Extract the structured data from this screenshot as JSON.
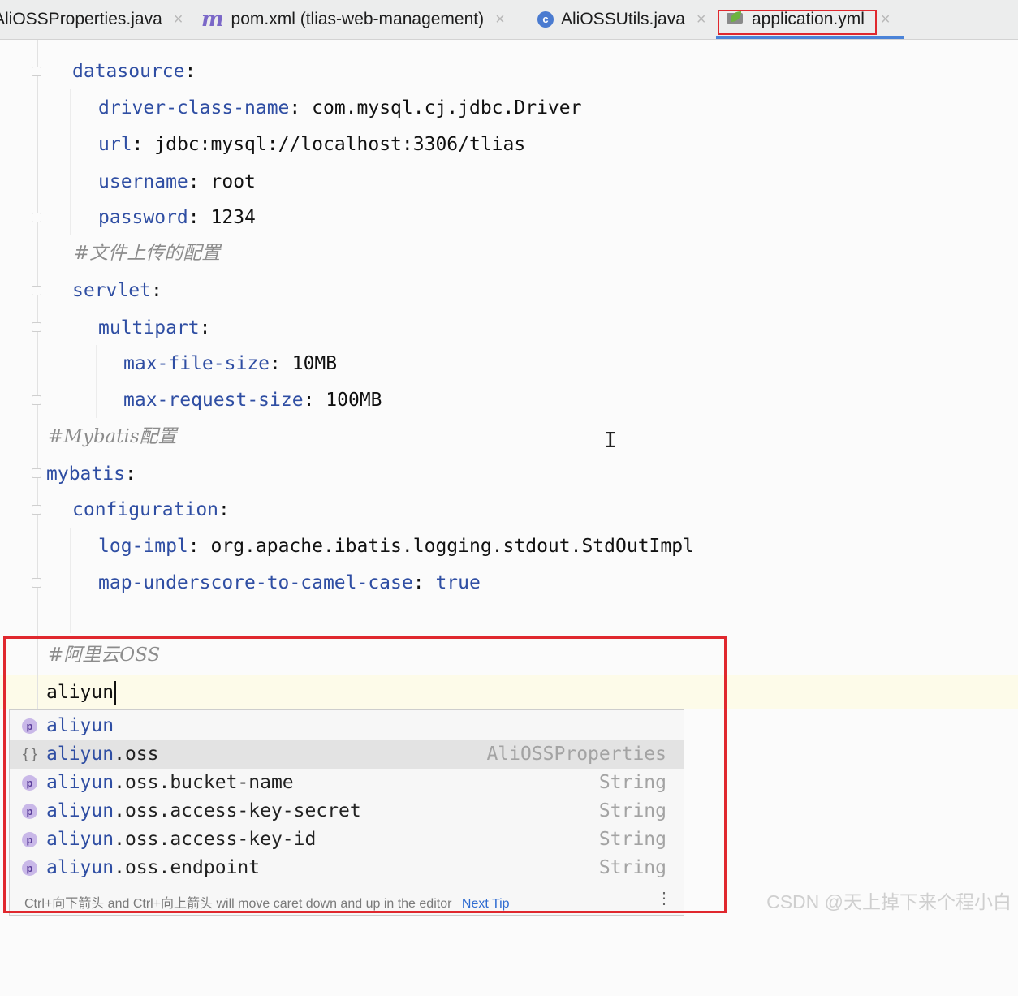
{
  "tabs": [
    {
      "label": "AliOSSProperties.java",
      "icon": "java-class-icon"
    },
    {
      "label": "pom.xml (tlias-web-management)",
      "icon": "maven-icon"
    },
    {
      "label": "AliOSSUtils.java",
      "icon": "class-icon"
    },
    {
      "label": "application.yml",
      "icon": "spring-yml-icon",
      "active": true
    }
  ],
  "code": {
    "l1_key": "datasource",
    "colon": ":",
    "l2_key": "driver-class-name",
    "l2_val": "com.mysql.cj.jdbc.Driver",
    "l3_key": "url",
    "l3_val": "jdbc:mysql://localhost:3306/tlias",
    "l4_key": "username",
    "l4_val": "root",
    "l5_key": "password",
    "l5_val": "1234",
    "l6_comment": "#文件上传的配置",
    "l7_key": "servlet",
    "l8_key": "multipart",
    "l9_key": "max-file-size",
    "l9_val": "10MB",
    "l10_key": "max-request-size",
    "l10_val": "100MB",
    "l11_comment": "#Mybatis配置",
    "l12_key": "mybatis",
    "l13_key": "configuration",
    "l14_key": "log-impl",
    "l14_val": "org.apache.ibatis.logging.stdout.StdOutImpl",
    "l15_key": "map-underscore-to-camel-case",
    "l15_val": "true",
    "l16_comment": "#阿里云OSS",
    "l17_typed": "aliyun"
  },
  "completion": {
    "items": [
      {
        "match": "aliyun",
        "rest": "",
        "type": "",
        "icon": "property-icon"
      },
      {
        "match": "aliyun",
        "rest": ".oss",
        "type": "AliOSSProperties",
        "icon": "object-icon"
      },
      {
        "match": "aliyun",
        "rest": ".oss.bucket-name",
        "type": "String",
        "icon": "property-icon"
      },
      {
        "match": "aliyun",
        "rest": ".oss.access-key-secret",
        "type": "String",
        "icon": "property-icon"
      },
      {
        "match": "aliyun",
        "rest": ".oss.access-key-id",
        "type": "String",
        "icon": "property-icon"
      },
      {
        "match": "aliyun",
        "rest": ".oss.endpoint",
        "type": "String",
        "icon": "property-icon"
      }
    ],
    "p_glyph": "p",
    "obj_glyph": "{}",
    "hint": "Ctrl+向下箭头 and Ctrl+向上箭头 will move caret down and up in the editor",
    "next_tip": "Next Tip",
    "kebab": "⋮"
  },
  "tab_glyphs": {
    "maven": "m",
    "class": "c",
    "close": "×"
  },
  "watermark": "CSDN @天上掉下来个程小白",
  "colors": {
    "accent": "#4a83d8",
    "highlight_box": "#e0282e",
    "key": "#2f4ea3"
  }
}
